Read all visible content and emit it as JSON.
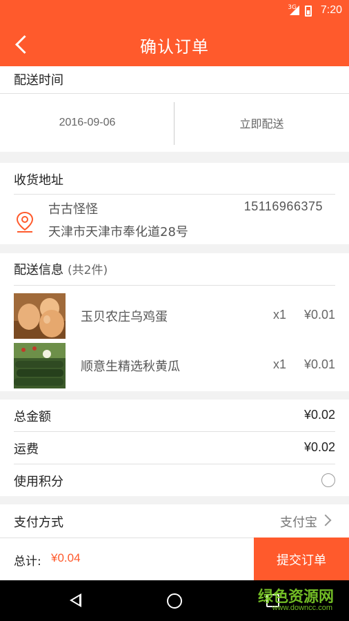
{
  "status_bar": {
    "time": "7:20",
    "network": "3G"
  },
  "header": {
    "title": "确认订单"
  },
  "delivery_time": {
    "label": "配送时间",
    "date": "2016-09-06",
    "mode": "立即配送"
  },
  "address": {
    "label": "收货地址",
    "name": "古古怪怪",
    "phone": "15116966375",
    "address_line": "天津市天津市奉化道28号"
  },
  "delivery_info": {
    "label": "配送信息",
    "count": "(共2件)",
    "items": [
      {
        "name": "玉贝农庄乌鸡蛋",
        "qty": "x1",
        "price": "¥0.01"
      },
      {
        "name": "顺意生精选秋黄瓜",
        "qty": "x1",
        "price": "¥0.01"
      }
    ]
  },
  "totals": {
    "total_amount_label": "总金额",
    "total_amount": "¥0.02",
    "shipping_label": "运费",
    "shipping": "¥0.02",
    "points_label": "使用积分"
  },
  "payment": {
    "label": "支付方式",
    "method": "支付宝"
  },
  "bottom_bar": {
    "total_label": "总计:",
    "total_value": "¥0.04",
    "submit_label": "提交订单"
  },
  "watermark": {
    "text": "绿色资源网",
    "url": "www.downcc.com"
  },
  "colors": {
    "accent": "#ff5a2c"
  }
}
